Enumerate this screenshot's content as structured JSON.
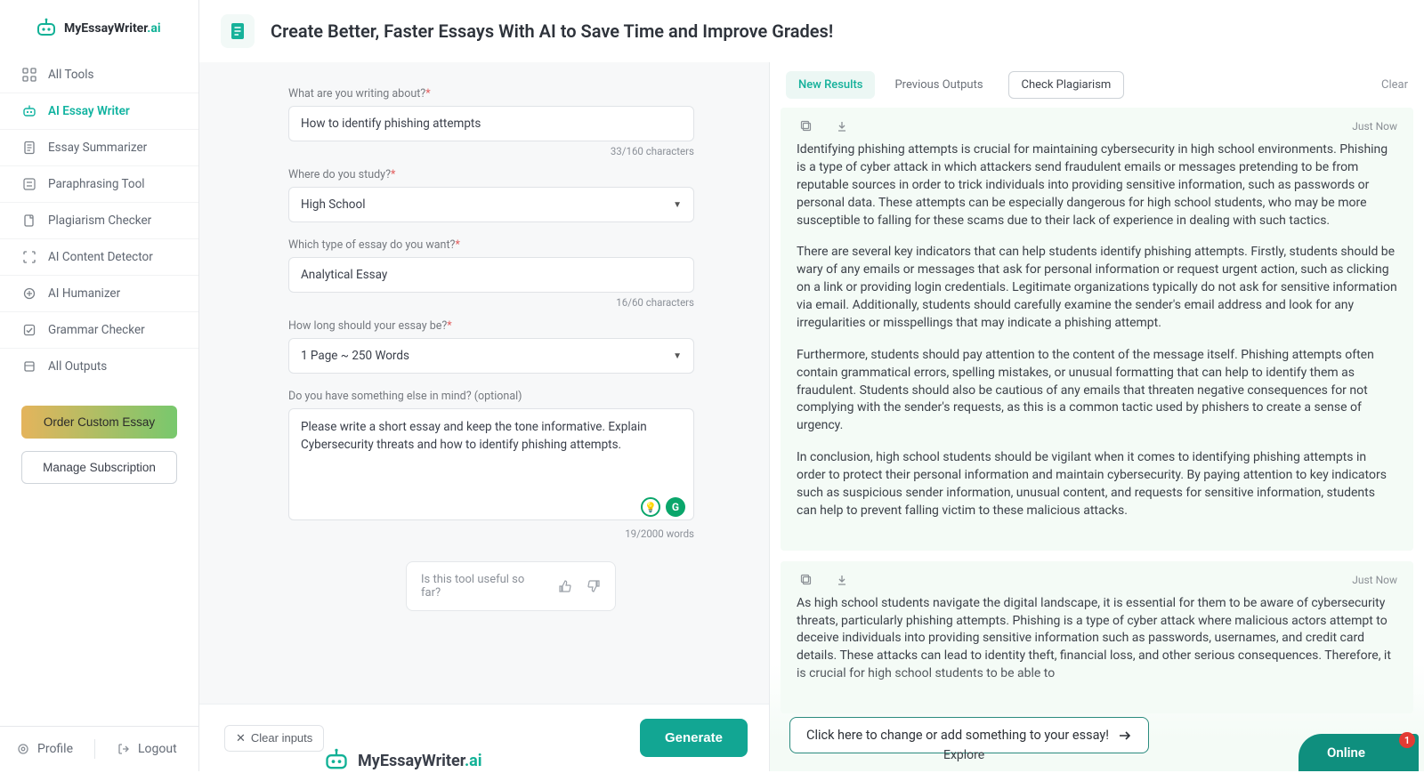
{
  "brand": {
    "name_part1": "MyEssayWriter",
    "name_part2": ".ai"
  },
  "sidebar": {
    "items": [
      {
        "label": "All Tools",
        "icon": "grid-icon"
      },
      {
        "label": "AI Essay Writer",
        "icon": "robot-icon",
        "active": true
      },
      {
        "label": "Essay Summarizer",
        "icon": "doc-icon"
      },
      {
        "label": "Paraphrasing Tool",
        "icon": "swap-icon"
      },
      {
        "label": "Plagiarism Checker",
        "icon": "paper-icon"
      },
      {
        "label": "AI Content Detector",
        "icon": "scan-icon"
      },
      {
        "label": "AI Humanizer",
        "icon": "wand-icon"
      },
      {
        "label": "Grammar Checker",
        "icon": "check-icon"
      },
      {
        "label": "All Outputs",
        "icon": "stack-icon"
      }
    ],
    "order_custom_label": "Order Custom Essay",
    "manage_sub_label": "Manage Subscription",
    "profile_label": "Profile",
    "logout_label": "Logout"
  },
  "header": {
    "title": "Create Better, Faster Essays With AI to Save Time and Improve Grades!"
  },
  "form": {
    "topic_label": "What are you writing about?",
    "topic_value": "How to identify phishing attempts",
    "topic_counter": "33/160 characters",
    "study_label": "Where do you study?",
    "study_value": "High School",
    "type_label": "Which type of essay do you want?",
    "type_value": "Analytical Essay",
    "type_counter": "16/60 characters",
    "length_label": "How long should your essay be?",
    "length_value": "1 Page ~ 250 Words",
    "extra_label": "Do you have something else in mind? (optional)",
    "extra_value": "Please write a short essay and keep the tone informative. Explain Cybersecurity threats and how to identify phishing attempts.",
    "extra_counter": "19/2000 words",
    "feedback_question": "Is this tool useful so far?",
    "clear_inputs_label": "Clear inputs",
    "generate_label": "Generate"
  },
  "output": {
    "tab_new": "New Results",
    "tab_prev": "Previous Outputs",
    "check_plag": "Check Plagiarism",
    "clear_label": "Clear",
    "timestamp": "Just Now",
    "result1": {
      "p1": "Identifying phishing attempts is crucial for maintaining cybersecurity in high school environments. Phishing is a type of cyber attack in which attackers send fraudulent emails or messages pretending to be from reputable sources in order to trick individuals into providing sensitive information, such as passwords or personal data. These attempts can be especially dangerous for high school students, who may be more susceptible to falling for these scams due to their lack of experience in dealing with such tactics.",
      "p2": "There are several key indicators that can help students identify phishing attempts. Firstly, students should be wary of any emails or messages that ask for personal information or request urgent action, such as clicking on a link or providing login credentials. Legitimate organizations typically do not ask for sensitive information via email. Additionally, students should carefully examine the sender's email address and look for any irregularities or misspellings that may indicate a phishing attempt.",
      "p3": "Furthermore, students should pay attention to the content of the message itself. Phishing attempts often contain grammatical errors, spelling mistakes, or unusual formatting that can help to identify them as fraudulent. Students should also be cautious of any emails that threaten negative consequences for not complying with the sender's requests, as this is a common tactic used by phishers to create a sense of urgency.",
      "p4": "In conclusion, high school students should be vigilant when it comes to identifying phishing attempts in order to protect their personal information and maintain cybersecurity. By paying attention to key indicators such as suspicious sender information, unusual content, and requests for sensitive information, students can help to prevent falling victim to these malicious attacks."
    },
    "result2": {
      "p1": "As high school students navigate the digital landscape, it is essential for them to be aware of cybersecurity threats, particularly phishing attempts. Phishing is a type of cyber attack where malicious actors attempt to deceive individuals into providing sensitive information such as passwords, usernames, and credit card details. These attacks can lead to identity theft, financial loss, and other serious consequences. Therefore, it is crucial for high school students to be able to"
    },
    "change_bar": "Click here to change or add something to your essay!"
  },
  "footer": {
    "explore": "Explore",
    "online": "Online",
    "badge": "1"
  }
}
